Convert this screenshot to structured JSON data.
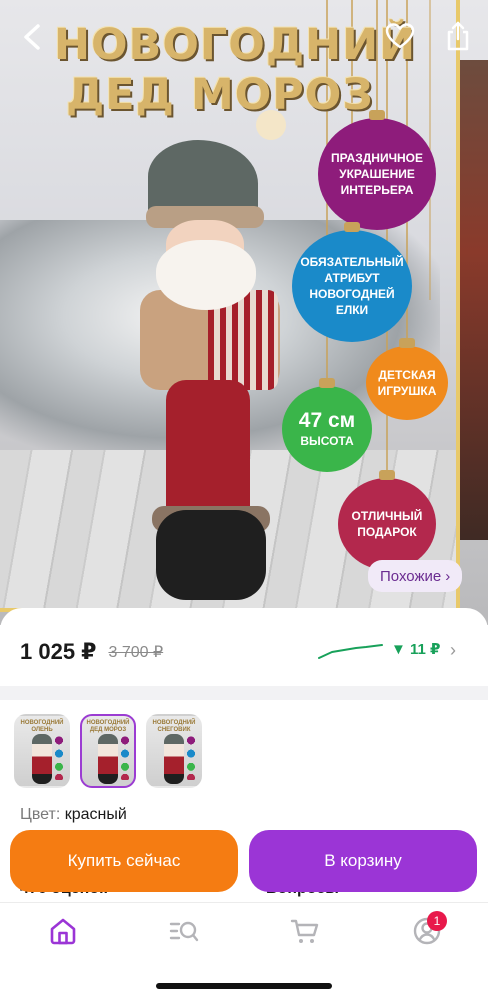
{
  "hero": {
    "title_line1": "НОВОГОДНИЙ",
    "title_line2": "ДЕД  МОРОЗ",
    "ball1": "ПРАЗДНИЧНОЕ УКРАШЕНИЕ ИНТЕРЬЕРА",
    "ball2": "ОБЯЗАТЕЛЬНЫЙ АТРИБУТ НОВОГОДНЕЙ ЕЛКИ",
    "ball3": "ДЕТСКАЯ ИГРУШКА",
    "ball4_big": "47 см",
    "ball4_small": "ВЫСОТА",
    "ball5": "ОТЛИЧНЫЙ ПОДАРОК",
    "similar_label": "Похожие",
    "similar_chevron": "›"
  },
  "price": {
    "current": "1 025 ₽",
    "old": "3 700 ₽",
    "bonus": "▼ 11 ₽",
    "chevron": "›"
  },
  "variants": [
    {
      "title": "НОВОГОДНИЙ ОЛЕНЬ",
      "selected": false
    },
    {
      "title": "НОВОГОДНИЙ ДЕД МОРОЗ",
      "selected": true
    },
    {
      "title": "НОВОГОДНИЙ СНЕГОВИК",
      "selected": false
    }
  ],
  "color": {
    "label": "Цвет:",
    "value": "красный"
  },
  "actions": {
    "buy_now": "Купить сейчас",
    "add_to_cart": "В корзину"
  },
  "peek": {
    "reviews": "476 оценок",
    "questions": "Вопросы"
  },
  "tabbar": {
    "profile_badge": "1"
  },
  "colors": {
    "buy": "#f57c12",
    "cart": "#9b35d6",
    "bonus": "#18a15a",
    "accent": "#6b2c91"
  }
}
